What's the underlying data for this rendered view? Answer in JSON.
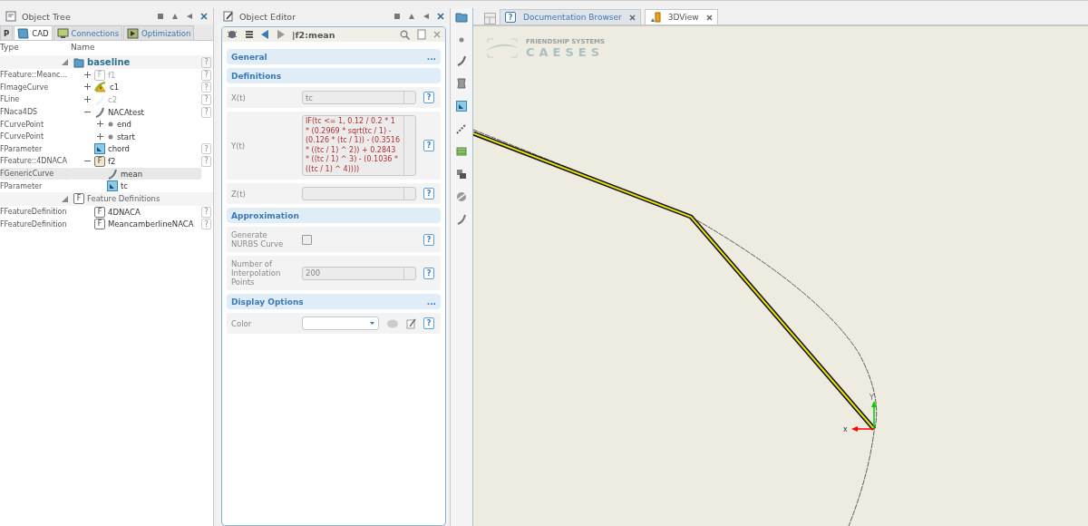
{
  "object_tree": {
    "title": "Object Tree",
    "tabs": [
      {
        "label": "P",
        "kind": "letter",
        "selected": false
      },
      {
        "label": "CAD",
        "kind": "cad",
        "selected": true
      },
      {
        "label": "Connections",
        "kind": "connections",
        "selected": false
      },
      {
        "label": "Optimization",
        "kind": "optimization",
        "selected": false
      }
    ],
    "columns": [
      "Type",
      "Name"
    ],
    "groups": [
      {
        "name": "baseline",
        "kind": "folder",
        "help": "?",
        "expanded": true,
        "children": [
          {
            "type": "FFeature::Meanc...",
            "name": "f1",
            "kind": "feature",
            "icon_text": "F",
            "disabled": true,
            "help": "?",
            "expanded": false,
            "selected": false
          },
          {
            "type": "FImageCurve",
            "name": "c1",
            "kind": "warning",
            "disabled": false,
            "help": "?",
            "expanded": false,
            "selected": false
          },
          {
            "type": "FLine",
            "name": "c2",
            "kind": "line",
            "disabled": true,
            "help": "?",
            "expanded": false,
            "selected": false
          },
          {
            "type": "FNaca4DS",
            "name": "NACAtest",
            "kind": "curve",
            "disabled": false,
            "help": "?",
            "expanded": true,
            "selected": false,
            "children": [
              {
                "type": "FCurvePoint",
                "name": "end",
                "kind": "point",
                "disabled": false,
                "expanded": false,
                "selected": false
              },
              {
                "type": "FCurvePoint",
                "name": "start",
                "kind": "point",
                "disabled": false,
                "expanded": false,
                "selected": false
              }
            ]
          },
          {
            "type": "FParameter",
            "name": "chord",
            "kind": "parameter",
            "disabled": false,
            "help": "?",
            "selected": false
          },
          {
            "type": "FFeature::4DNACA",
            "name": "f2",
            "kind": "feature-active",
            "icon_text": "F",
            "disabled": false,
            "help": "?",
            "expanded": true,
            "selected": false,
            "children": [
              {
                "type": "FGenericCurve",
                "name": "mean",
                "kind": "curve",
                "disabled": false,
                "selected": true
              },
              {
                "type": "FParameter",
                "name": "tc",
                "kind": "parameter",
                "disabled": false,
                "selected": false
              }
            ]
          }
        ]
      },
      {
        "name": "Feature Definitions",
        "kind": "feature",
        "icon_text": "F",
        "expanded": true,
        "children": [
          {
            "type": "FFeatureDefinition",
            "name": "4DNACA",
            "kind": "feature",
            "icon_text": "F",
            "disabled": false,
            "help": "?",
            "selected": false
          },
          {
            "type": "FFeatureDefinition",
            "name": "MeancamberlineNACA",
            "kind": "feature",
            "icon_text": "F",
            "disabled": false,
            "help": "?",
            "selected": false
          }
        ]
      }
    ]
  },
  "object_editor": {
    "title": "Object Editor",
    "path": "|f2:mean",
    "sections": [
      {
        "title": "General",
        "more": "..."
      },
      {
        "title": "Definitions",
        "rows": [
          {
            "kind": "field",
            "label": "X(t)",
            "value": "tc",
            "help": "?"
          },
          {
            "kind": "multiline",
            "label": "Y(t)",
            "value": "IF(tc <= 1, 0.12 / 0.2 * 1 * (0.2969 * sqrt(tc / 1) - (0.126 * (tc / 1)) - (0.3516 * ((tc / 1) ^ 2)) + 0.2843 * ((tc / 1) ^ 3) - (0.1036 * ((tc / 1) ^ 4))))",
            "help": "?"
          },
          {
            "kind": "field",
            "label": "Z(t)",
            "help": "?"
          }
        ]
      },
      {
        "title": "Approximation",
        "rows": [
          {
            "kind": "checkbox",
            "label": "Generate NURBS Curve",
            "checked": false,
            "help": "?"
          },
          {
            "kind": "field",
            "label": "Number of Interpolation Points",
            "value": "200",
            "help": "?"
          }
        ]
      },
      {
        "title": "Display Options",
        "more": "...",
        "rows": [
          {
            "kind": "color",
            "label": "Color",
            "help": "?"
          }
        ]
      }
    ]
  },
  "view_tabs": [
    {
      "label": "Documentation Browser",
      "kind": "doc",
      "icon_text": "?",
      "selected": false
    },
    {
      "label": "3DView",
      "kind": "view",
      "selected": true
    }
  ],
  "viewport": {
    "logo": {
      "company": "FRIENDSHIP SYSTEMS",
      "product": "CAESES"
    },
    "axes": {
      "x": "x",
      "y": "Y"
    }
  }
}
